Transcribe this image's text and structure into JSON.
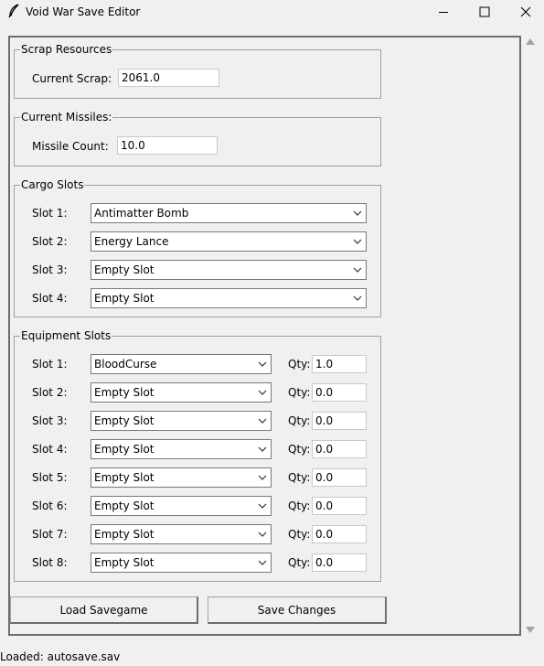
{
  "window": {
    "title": "Void War Save Editor"
  },
  "scrap": {
    "legend": "Scrap Resources",
    "label": "Current Scrap:",
    "value": "2061.0"
  },
  "missiles": {
    "legend": "Current Missiles:",
    "label": "Missile Count:",
    "value": "10.0"
  },
  "cargo": {
    "legend": "Cargo Slots",
    "slots": [
      {
        "label": "Slot 1:",
        "value": "Antimatter Bomb"
      },
      {
        "label": "Slot 2:",
        "value": "Energy Lance"
      },
      {
        "label": "Slot 3:",
        "value": "Empty Slot"
      },
      {
        "label": "Slot 4:",
        "value": "Empty Slot"
      }
    ]
  },
  "equipment": {
    "legend": "Equipment Slots",
    "qty_label": "Qty:",
    "slots": [
      {
        "label": "Slot 1:",
        "value": "BloodCurse",
        "qty": "1.0"
      },
      {
        "label": "Slot 2:",
        "value": "Empty Slot",
        "qty": "0.0"
      },
      {
        "label": "Slot 3:",
        "value": "Empty Slot",
        "qty": "0.0"
      },
      {
        "label": "Slot 4:",
        "value": "Empty Slot",
        "qty": "0.0"
      },
      {
        "label": "Slot 5:",
        "value": "Empty Slot",
        "qty": "0.0"
      },
      {
        "label": "Slot 6:",
        "value": "Empty Slot",
        "qty": "0.0"
      },
      {
        "label": "Slot 7:",
        "value": "Empty Slot",
        "qty": "0.0"
      },
      {
        "label": "Slot 8:",
        "value": "Empty Slot",
        "qty": "0.0"
      }
    ]
  },
  "buttons": {
    "load": "Load Savegame",
    "save": "Save Changes"
  },
  "status": {
    "text": "Loaded: autosave.sav"
  },
  "icons": {
    "app": "feather-icon",
    "minimize": "minimize-icon",
    "maximize": "maximize-icon",
    "close": "close-icon",
    "dropdown": "chevron-down-icon"
  }
}
